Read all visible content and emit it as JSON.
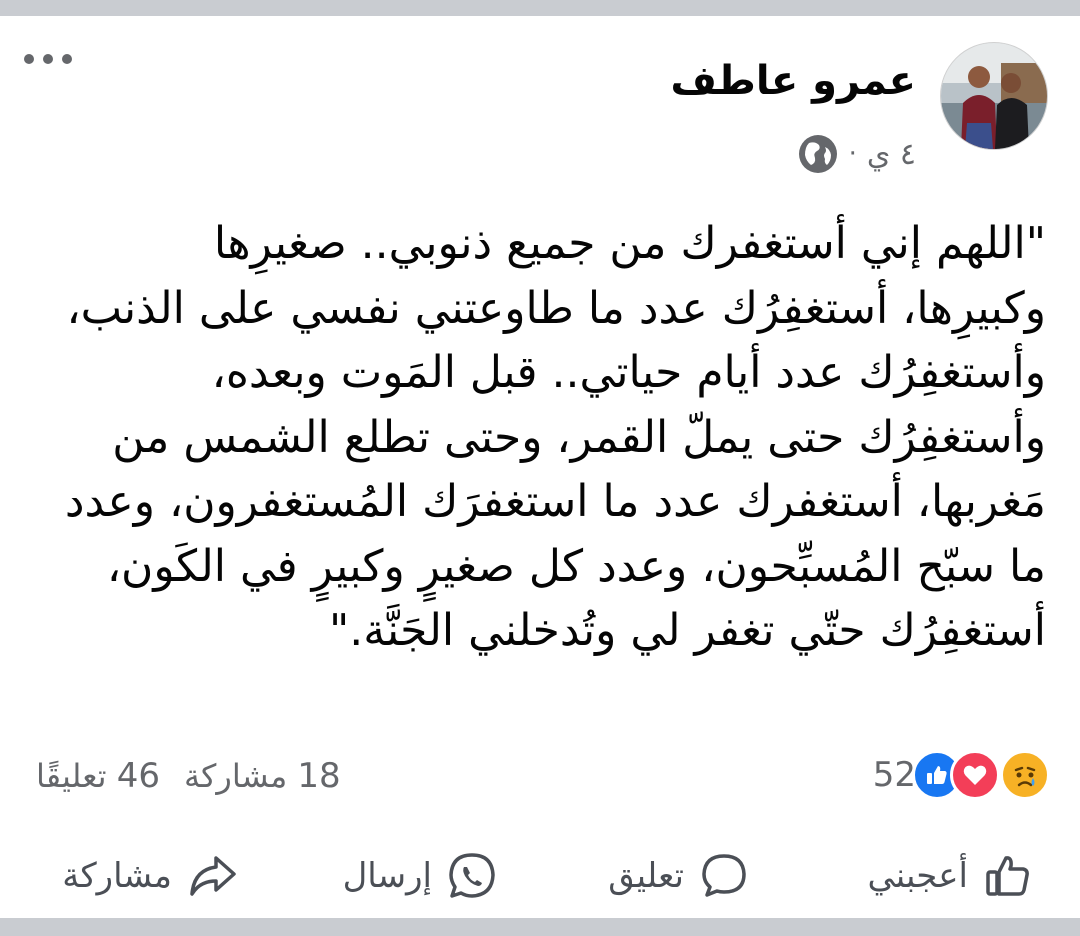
{
  "post": {
    "author": "عمرو عاطف",
    "time": "٤ ي",
    "meta_dot": "·",
    "privacy_icon": "globe-icon",
    "more_icon": "more-dots-icon",
    "body_lines": [
      "\"اللهم إني أستغفرك من جميع ذنوبي.. صغيرِها",
      "وكبيرِها، أستغفِرُك عدد ما طاوعتني نفسي على الذنب،",
      "وأستغفِرُك عدد أيام حياتي.. قبل المَوت وبعده،",
      "وأستغفِرُك حتى يملّ القمر، وحتى تطلع الشمس من",
      "مَغربها، أستغفرك عدد ما استغفرَك المُستغفرون، وعدد",
      "ما سبّح المُسبِّحون، وعدد كل صغيرٍ وكبيرٍ في الكَون،",
      "أستغفِرُك حتّي تغفر لي وتُدخلني الجَنَّة.\""
    ]
  },
  "stats": {
    "reactions_count": "52",
    "reaction_icons": [
      "sad-reaction-icon",
      "love-reaction-icon",
      "like-reaction-icon"
    ],
    "comments_number": "46",
    "comments_label": "تعليقًا",
    "shares_number": "18",
    "shares_label": "مشاركة"
  },
  "actions": {
    "like": "أعجبني",
    "comment": "تعليق",
    "send": "إرسال",
    "share": "مشاركة"
  },
  "colors": {
    "background": "#ffffff",
    "separator": "#c9ccd1",
    "secondary_text": "#65676b",
    "like_blue": "#1877f2",
    "love_red": "#f33e58",
    "sad_yellow": "#f7b125"
  }
}
